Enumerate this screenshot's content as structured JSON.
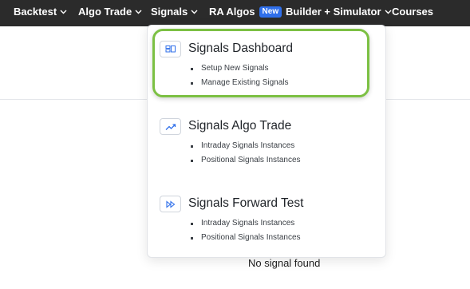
{
  "nav": {
    "items": [
      {
        "label": "Backtest",
        "dropdown": true
      },
      {
        "label": "Algo Trade",
        "dropdown": true
      },
      {
        "label": "Signals",
        "dropdown": true
      },
      {
        "label": "RA Algos",
        "badge": "New",
        "dropdown": false
      },
      {
        "label": "Builder + Simulator",
        "dropdown": true
      },
      {
        "label": "Courses",
        "dropdown": false
      }
    ]
  },
  "dropdown": {
    "sections": [
      {
        "icon": "dashboard-icon",
        "title": "Signals Dashboard",
        "items": [
          "Setup New Signals",
          "Manage Existing Signals"
        ]
      },
      {
        "icon": "trending-up-icon",
        "title": "Signals Algo Trade",
        "items": [
          "Intraday Signals Instances",
          "Positional Signals Instances"
        ]
      },
      {
        "icon": "fast-forward-icon",
        "title": "Signals Forward Test",
        "items": [
          "Intraday Signals Instances",
          "Positional Signals Instances"
        ]
      }
    ]
  },
  "main": {
    "empty_message": "No signal found"
  },
  "colors": {
    "nav_bg": "#2b2b2b",
    "badge_bg": "#2f6fea",
    "highlight": "#7cc043",
    "icon_accent": "#2f6fea"
  }
}
